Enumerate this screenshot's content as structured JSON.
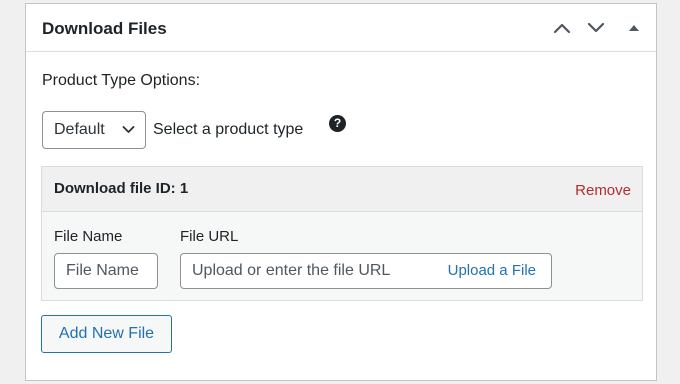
{
  "panel": {
    "title": "Download Files",
    "controls": [
      "move-up-icon",
      "move-down-icon",
      "toggle-panel-icon"
    ]
  },
  "product_type": {
    "label": "Product Type Options:",
    "select_value": "Default",
    "help_text": "Select a product type",
    "help_icon": "?"
  },
  "file_item": {
    "title": "Download file ID: 1",
    "remove_label": "Remove",
    "name_label": "File Name",
    "name_placeholder": "File Name",
    "url_label": "File URL",
    "url_placeholder": "Upload or enter the file URL",
    "upload_label": "Upload a File"
  },
  "add_button_label": "Add New File",
  "colors": {
    "link": "#2271b1",
    "danger": "#b32d2e",
    "text": "#1d2327",
    "border": "#c3c4c7"
  }
}
